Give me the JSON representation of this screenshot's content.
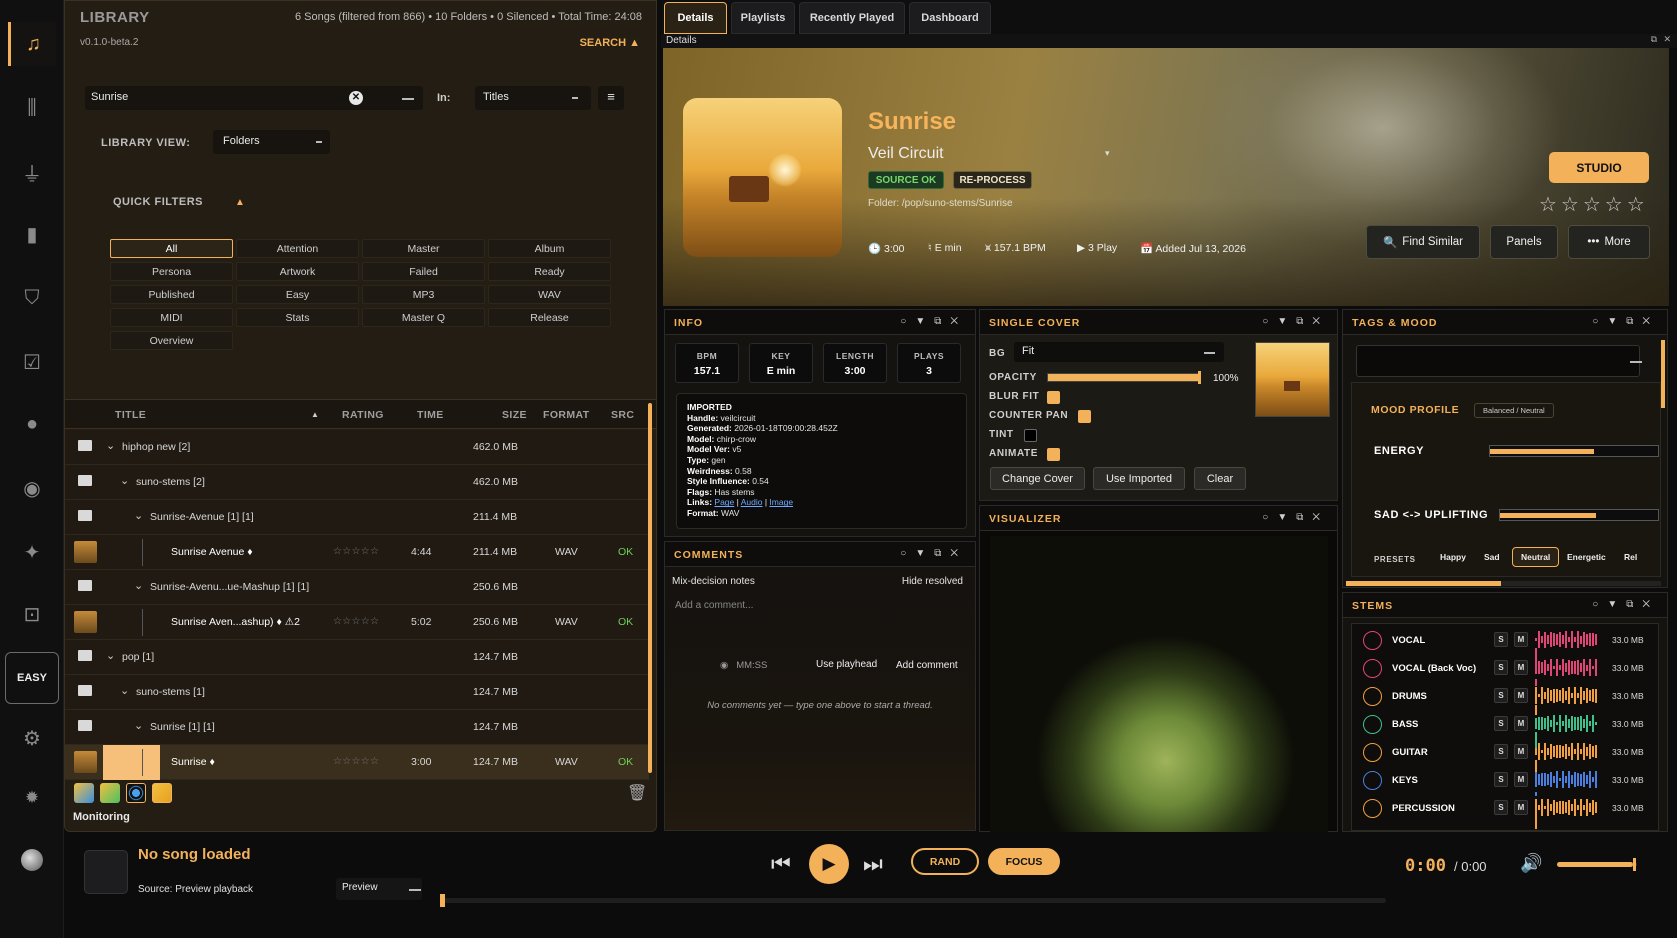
{
  "rail": {
    "items": [
      {
        "icon": "music-library-icon",
        "glyph": "♫"
      },
      {
        "icon": "mixer-sliders-icon",
        "glyph": "⫼"
      },
      {
        "icon": "plug-icon",
        "glyph": "⏚"
      },
      {
        "icon": "bar-chart-icon",
        "glyph": "▮"
      },
      {
        "icon": "shield-check-icon",
        "glyph": "⛉"
      },
      {
        "icon": "checklist-icon",
        "glyph": "☑"
      },
      {
        "icon": "user-icon",
        "glyph": "●"
      },
      {
        "icon": "disc-icon",
        "glyph": "◉"
      },
      {
        "icon": "sparkle-icon",
        "glyph": "✦"
      },
      {
        "icon": "square-dot-icon",
        "glyph": "⊡"
      }
    ],
    "easy_label": "EASY",
    "settings_glyph": "⚙",
    "bulb_glyph": "💡"
  },
  "library": {
    "title": "LIBRARY",
    "stats": "6 Songs (filtered from 866) • 10 Folders • 0 Silenced • Total Time: 24:08",
    "version": "v0.1.0-beta.2",
    "search_toggle": "SEARCH ▲",
    "search_value": "Sunrise",
    "in_label": "In:",
    "in_value": "Titles",
    "view_label": "LIBRARY VIEW:",
    "view_value": "Folders",
    "quick_filters_label": "QUICK FILTERS",
    "quick_filters_toggle": "▲",
    "quick_filters": [
      "All",
      "Attention",
      "Master",
      "Album",
      "Persona",
      "Artwork",
      "Failed",
      "Ready",
      "Published",
      "Easy",
      "MP3",
      "WAV",
      "MIDI",
      "Stats",
      "Master Q",
      "Release",
      "Overview"
    ],
    "columns": {
      "title": "TITLE",
      "sort": "▲",
      "rating": "RATING",
      "time": "TIME",
      "size": "SIZE",
      "format": "FORMAT",
      "src": "SRC"
    },
    "rows": [
      {
        "kind": "folder",
        "indent": 0,
        "title": "hiphop new [2]",
        "size": "462.0 MB"
      },
      {
        "kind": "folder",
        "indent": 1,
        "title": "suno-stems [2]",
        "size": "462.0 MB"
      },
      {
        "kind": "folder",
        "indent": 2,
        "title": "Sunrise-Avenue [1] [1]",
        "size": "211.4 MB"
      },
      {
        "kind": "song",
        "indent": 3,
        "title": "Sunrise Avenue ♦",
        "rating": "☆☆☆☆☆",
        "time": "4:44",
        "size": "211.4 MB",
        "format": "WAV",
        "src": "OK"
      },
      {
        "kind": "folder",
        "indent": 2,
        "title": "Sunrise-Avenu...ue-Mashup [1] [1]",
        "size": "250.6 MB"
      },
      {
        "kind": "song",
        "indent": 3,
        "title": "Sunrise Aven...ashup) ♦  ⚠2",
        "rating": "☆☆☆☆☆",
        "time": "5:02",
        "size": "250.6 MB",
        "format": "WAV",
        "src": "OK"
      },
      {
        "kind": "folder",
        "indent": 0,
        "title": "pop [1]",
        "size": "124.7 MB"
      },
      {
        "kind": "folder",
        "indent": 1,
        "title": "suno-stems [1]",
        "size": "124.7 MB"
      },
      {
        "kind": "folder",
        "indent": 2,
        "title": "Sunrise [1] [1]",
        "size": "124.7 MB"
      },
      {
        "kind": "song",
        "indent": 3,
        "selected": true,
        "title": "Sunrise ♦",
        "rating": "☆☆☆☆☆",
        "time": "3:00",
        "size": "124.7 MB",
        "format": "WAV",
        "src": "OK"
      }
    ],
    "footer_label": "Monitoring"
  },
  "tabs": [
    "Details",
    "Playlists",
    "Recently Played",
    "Dashboard"
  ],
  "details_label": "Details",
  "hero": {
    "title": "Sunrise",
    "artist": "Veil Circuit",
    "source_badge": "SOURCE OK",
    "reprocess": "RE-PROCESS",
    "folder": "Folder: /pop/suno-stems/Sunrise",
    "length": "3:00",
    "key": "E min",
    "bpm": "157.1 BPM",
    "plays": "3 Play",
    "added": "Added Jul 13, 2026",
    "studio": "STUDIO",
    "stars": "☆☆☆☆☆",
    "find_similar": "Find Similar",
    "panels": "Panels",
    "more": "More"
  },
  "info": {
    "title": "INFO",
    "stats": [
      {
        "label": "BPM",
        "value": "157.1"
      },
      {
        "label": "KEY",
        "value": "E min"
      },
      {
        "label": "LENGTH",
        "value": "3:00"
      },
      {
        "label": "PLAYS",
        "value": "3"
      }
    ],
    "imported_heading": "IMPORTED",
    "fields": [
      {
        "k": "Handle:",
        "v": "veilcircuit"
      },
      {
        "k": "Generated:",
        "v": "2026-01-18T09:00:28.452Z"
      },
      {
        "k": "Model:",
        "v": "chirp-crow"
      },
      {
        "k": "Model Ver:",
        "v": "v5"
      },
      {
        "k": "Type:",
        "v": "gen"
      },
      {
        "k": "Weirdness:",
        "v": "0.58"
      },
      {
        "k": "Style Influence:",
        "v": "0.54"
      },
      {
        "k": "Flags:",
        "v": "Has stems"
      }
    ],
    "links_label": "Links:",
    "links": [
      "Page",
      "Audio",
      "Image"
    ],
    "format_label": "Format:",
    "format_value": "WAV"
  },
  "comments": {
    "title": "COMMENTS",
    "subtitle": "Mix-decision notes",
    "hide_resolved": "Hide resolved",
    "placeholder": "Add a comment...",
    "time_placeholder": "MM:SS",
    "use_playhead": "Use playhead",
    "add_comment": "Add comment",
    "empty": "No comments yet — type one above to start a thread."
  },
  "single_cover": {
    "title": "SINGLE COVER",
    "bg_label": "BG",
    "bg_value": "Fit",
    "opacity_label": "OPACITY",
    "opacity_value": "100%",
    "opacity": 1.0,
    "blur_fit": "BLUR FIT",
    "counter_pan": "COUNTER PAN",
    "tint": "TINT",
    "animate": "ANIMATE",
    "change_cover": "Change Cover",
    "use_imported": "Use Imported",
    "clear": "Clear"
  },
  "visualizer": {
    "title": "VISUALIZER"
  },
  "tags": {
    "title": "TAGS & MOOD",
    "mood_profile": "MOOD PROFILE",
    "mood_badge": "Balanced / Neutral",
    "energy_label": "ENERGY",
    "energy": 0.62,
    "sad_label": "SAD <-> UPLIFTING",
    "sad": 0.61,
    "presets_label": "PRESETS",
    "presets": [
      "Happy",
      "Sad",
      "Neutral",
      "Energetic",
      "Rel"
    ],
    "active_preset": "Neutral"
  },
  "stems": {
    "title": "STEMS",
    "items": [
      {
        "name": "VOCAL",
        "color": "#e0457a",
        "size": "33.0 MB"
      },
      {
        "name": "VOCAL (Back Voc)",
        "color": "#e0457a",
        "size": "33.0 MB"
      },
      {
        "name": "DRUMS",
        "color": "#f0a040",
        "size": "33.0 MB"
      },
      {
        "name": "BASS",
        "color": "#3fbf8a",
        "size": "33.0 MB"
      },
      {
        "name": "GUITAR",
        "color": "#f0a040",
        "size": "33.0 MB"
      },
      {
        "name": "KEYS",
        "color": "#4a7fe0",
        "size": "33.0 MB"
      },
      {
        "name": "PERCUSSION",
        "color": "#f0a040",
        "size": "33.0 MB"
      }
    ],
    "solo": "S",
    "mute": "M"
  },
  "player": {
    "title": "No song loaded",
    "source": "Source: Preview playback",
    "mode": "Preview",
    "rand": "RAND",
    "focus": "FOCUS",
    "elapsed": "0:00",
    "total": "/ 0:00",
    "progress": 0.0,
    "volume": 0.95
  },
  "colors": {
    "accent": "#f3b15a",
    "ok": "#6fcf5b"
  }
}
